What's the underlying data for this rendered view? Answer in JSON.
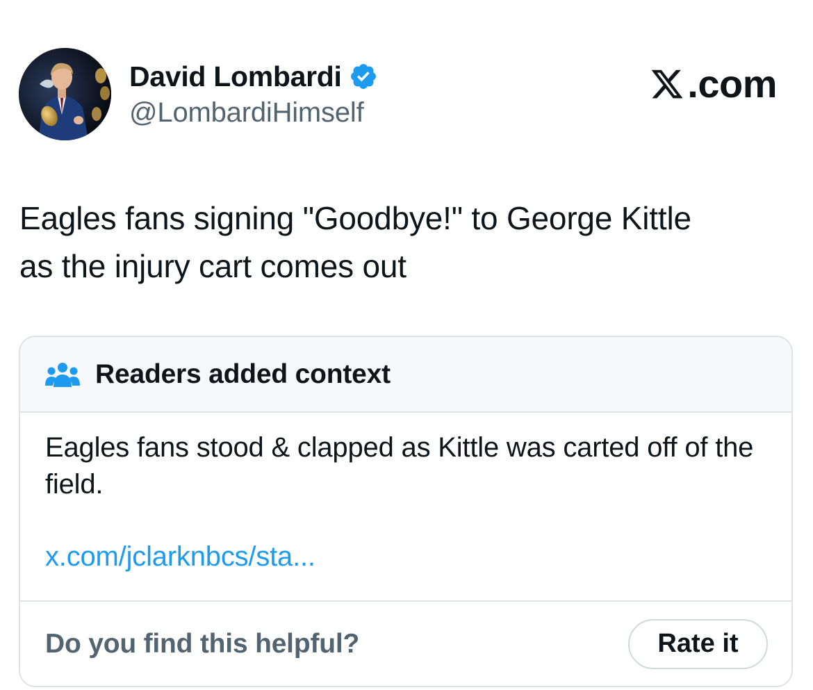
{
  "tweet": {
    "display_name": "David Lombardi",
    "handle": "@LombardiHimself",
    "verified": true,
    "verified_icon": "verified-badge-icon",
    "text_line1": "Eagles fans signing \"Goodbye!\" to George Kittle",
    "text_line2": "as the injury cart comes out"
  },
  "brand": {
    "label": ".com",
    "icon": "x-logo-icon"
  },
  "community_note": {
    "icon": "readers-icon",
    "title": "Readers added context",
    "text": "Eagles fans stood & clapped as Kittle was carted off of the field.",
    "link_text": "x.com/jclarknbcs/sta...",
    "helpful_question": "Do you find this helpful?",
    "rate_button_label": "Rate it"
  },
  "colors": {
    "text_primary": "#0f1419",
    "text_secondary": "#536471",
    "link_blue": "#1d9bf0",
    "verified_blue": "#1d9bf0",
    "border": "#dfe3e6",
    "header_bg": "#f6f8f9"
  }
}
